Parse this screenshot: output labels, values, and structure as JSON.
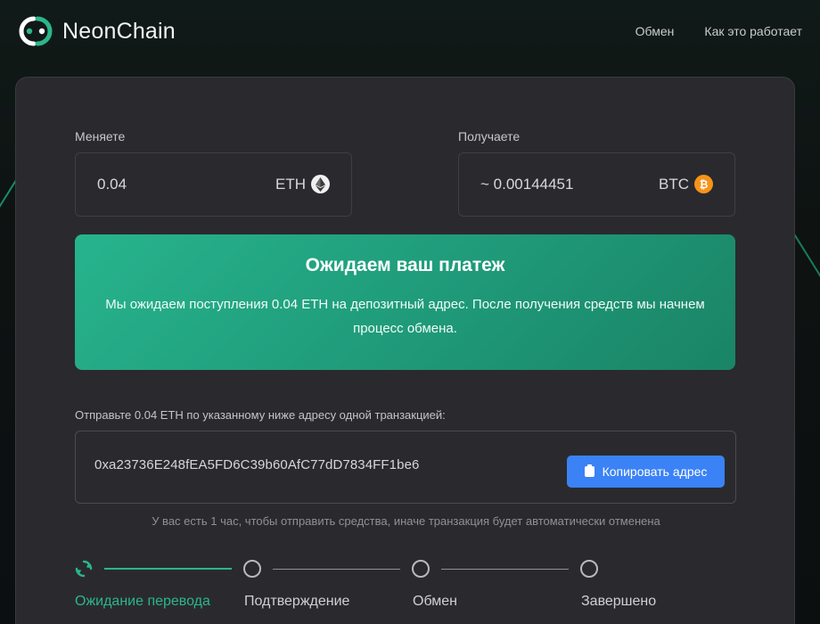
{
  "brand": {
    "name": "NeonChain",
    "logo_icon": "neonchain-logo-icon",
    "accent_color": "#2bb68b"
  },
  "nav": {
    "items": [
      {
        "label": "Обмен"
      },
      {
        "label": "Как это работает"
      }
    ]
  },
  "exchange": {
    "send": {
      "label": "Меняете",
      "amount": "0.04",
      "currency": "ETH",
      "icon": "eth-icon"
    },
    "receive": {
      "label": "Получаете",
      "amount": "~ 0.00144451",
      "currency": "BTC",
      "icon": "btc-icon"
    }
  },
  "status": {
    "title": "Ожидаем ваш платеж",
    "message": "Мы ожидаем поступления 0.04 ETH на депозитный адрес. После получения средств мы начнем процесс обмена."
  },
  "deposit": {
    "instruction": "Отправьте 0.04 ETH по указанному ниже адресу одной транзакцией:",
    "address": "0xa23736E248fEA5FD6C39b60AfC77dD7834FF1be6",
    "copy_label": "Копировать адрес",
    "timeout_note": "У вас есть 1 час, чтобы отправить средства, иначе транзакция будет автоматически отменена"
  },
  "progress": {
    "current_step": 1,
    "steps": [
      {
        "label": "Ожидание перевода"
      },
      {
        "label": "Подтверждение"
      },
      {
        "label": "Обмен"
      },
      {
        "label": "Завершено"
      }
    ]
  }
}
